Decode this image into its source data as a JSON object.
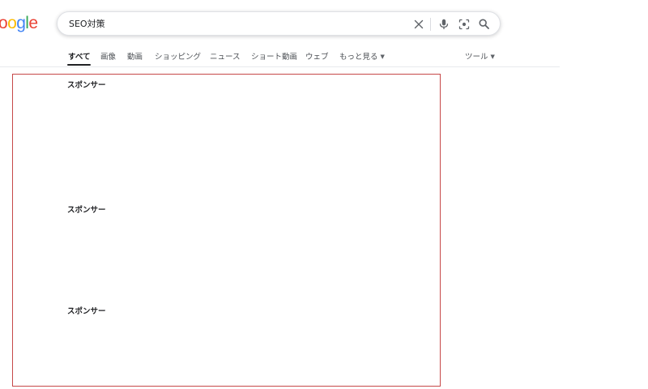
{
  "logo": {
    "letters": [
      "o",
      "o",
      "g",
      "l",
      "e"
    ],
    "colors": [
      "#ea4335",
      "#fbbc05",
      "#4285f4",
      "#34a853",
      "#ea4335"
    ]
  },
  "search": {
    "value": "SEO対策",
    "placeholder": ""
  },
  "search_icons": [
    "clear-icon",
    "microphone-icon",
    "camera-search-icon",
    "search-icon"
  ],
  "tabs": [
    {
      "label": "すべて",
      "active": true
    },
    {
      "label": "画像"
    },
    {
      "label": "動画"
    },
    {
      "label": "ショッピング"
    },
    {
      "label": "ニュース"
    },
    {
      "label": "ショート動画"
    },
    {
      "label": "ウェブ"
    },
    {
      "label": "もっと見る"
    }
  ],
  "tools_label": "ツール",
  "ads": [
    {
      "label": "スポンサー"
    },
    {
      "label": "スポンサー"
    },
    {
      "label": "スポンサー"
    }
  ],
  "colors": {
    "highlight_border": "#c64848",
    "text": "#202124",
    "muted": "#4d5156"
  }
}
